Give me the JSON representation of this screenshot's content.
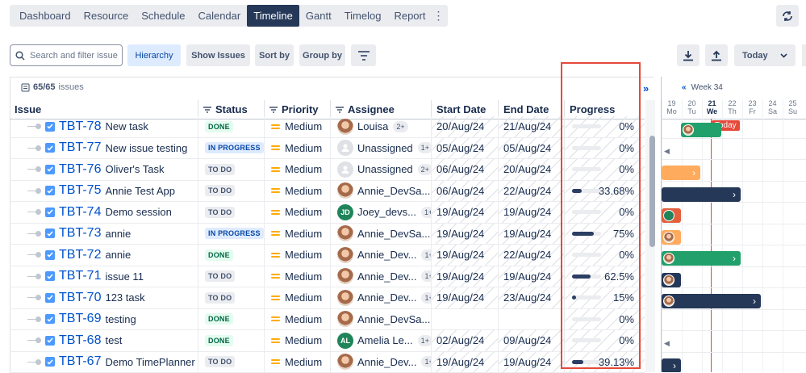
{
  "nav": {
    "tabs": [
      "Dashboard",
      "Resource",
      "Schedule",
      "Calendar",
      "Timeline",
      "Gantt",
      "Timelog",
      "Report"
    ],
    "active_tab": "Timeline",
    "more_icon": "more-vertical-icon",
    "refresh_icon": "refresh-icon"
  },
  "toolbar": {
    "search_placeholder": "Search and filter issue",
    "hierarchy": "Hierarchy",
    "show_issues": "Show Issues",
    "sort_by": "Sort by",
    "group_by": "Group by",
    "filter_icon": "filter-lines-icon",
    "download_icon": "download-icon",
    "upload_icon": "upload-icon",
    "range": "Today"
  },
  "summary": {
    "count": "65/65",
    "label": "issues"
  },
  "columns": {
    "issue": "Issue",
    "status": "Status",
    "priority": "Priority",
    "assignee": "Assignee",
    "start": "Start Date",
    "end": "End Date",
    "progress": "Progress"
  },
  "rows": [
    {
      "key": "TBT-78",
      "title": "New task",
      "status": "DONE",
      "priority": "Medium",
      "assignee": "Louisa",
      "badge": "2+",
      "avatar": "photo",
      "start": "20/Aug/24",
      "end": "21/Aug/24",
      "progress": "0%",
      "fill": 0
    },
    {
      "key": "TBT-77",
      "title": "New issue testing",
      "status": "IN PROGRESS",
      "priority": "Medium",
      "assignee": "Unassigned",
      "badge": "1+",
      "avatar": "unassigned",
      "start": "05/Aug/24",
      "end": "05/Aug/24",
      "progress": "0%",
      "fill": 0
    },
    {
      "key": "TBT-76",
      "title": "Oliver's Task",
      "status": "TO DO",
      "priority": "Medium",
      "assignee": "Unassigned",
      "badge": "2+",
      "avatar": "unassigned",
      "start": "06/Aug/24",
      "end": "20/Aug/24",
      "progress": "0%",
      "fill": 0
    },
    {
      "key": "TBT-75",
      "title": "Annie Test App",
      "status": "TO DO",
      "priority": "Medium",
      "assignee": "Annie_DevSa...",
      "badge": "",
      "avatar": "photo",
      "start": "06/Aug/24",
      "end": "22/Aug/24",
      "progress": "33.68%",
      "fill": 0.3368
    },
    {
      "key": "TBT-74",
      "title": "Demo session",
      "status": "TO DO",
      "priority": "Medium",
      "assignee": "Joey_devs...",
      "badge": "1+",
      "avatar": "JD",
      "start": "19/Aug/24",
      "end": "19/Aug/24",
      "progress": "0%",
      "fill": 0
    },
    {
      "key": "TBT-73",
      "title": "annie",
      "status": "IN PROGRESS",
      "priority": "Medium",
      "assignee": "Annie_DevSa...",
      "badge": "",
      "avatar": "photo",
      "start": "19/Aug/24",
      "end": "19/Aug/24",
      "progress": "75%",
      "fill": 0.75
    },
    {
      "key": "TBT-72",
      "title": "annie",
      "status": "DONE",
      "priority": "Medium",
      "assignee": "Annie_Dev...",
      "badge": "1+",
      "avatar": "photo",
      "start": "19/Aug/24",
      "end": "22/Aug/24",
      "progress": "0%",
      "fill": 0
    },
    {
      "key": "TBT-71",
      "title": "issue 11",
      "status": "TO DO",
      "priority": "Medium",
      "assignee": "Annie_Dev...",
      "badge": "1+",
      "avatar": "photo",
      "start": "19/Aug/24",
      "end": "19/Aug/24",
      "progress": "62.5%",
      "fill": 0.625
    },
    {
      "key": "TBT-70",
      "title": "123 task",
      "status": "TO DO",
      "priority": "Medium",
      "assignee": "Annie_Dev...",
      "badge": "1+",
      "avatar": "photo",
      "start": "19/Aug/24",
      "end": "23/Aug/24",
      "progress": "15%",
      "fill": 0.15
    },
    {
      "key": "TBT-69",
      "title": "testing",
      "status": "DONE",
      "priority": "Medium",
      "assignee": "Annie_DevSa...",
      "badge": "",
      "avatar": "photo",
      "start": "",
      "end": "",
      "progress": "0%",
      "fill": 0
    },
    {
      "key": "TBT-68",
      "title": "test",
      "status": "DONE",
      "priority": "Medium",
      "assignee": "Amelia Le...",
      "badge": "1+",
      "avatar": "AL",
      "start": "02/Aug/24",
      "end": "09/Aug/24",
      "progress": "0%",
      "fill": 0
    },
    {
      "key": "TBT-67",
      "title": "Demo TimePlanner",
      "status": "TO DO",
      "priority": "Medium",
      "assignee": "Annie_Dev...",
      "badge": "1+",
      "avatar": "photo",
      "start": "19/Aug/24",
      "end": "19/Aug/24",
      "progress": "39.13%",
      "fill": 0.3913
    }
  ],
  "timeline": {
    "week": "Week 34",
    "today_label": "Today",
    "days": [
      {
        "num": "19",
        "dow": "Mo"
      },
      {
        "num": "20",
        "dow": "Tu"
      },
      {
        "num": "21",
        "dow": "We",
        "today": true
      },
      {
        "num": "22",
        "dow": "Th"
      },
      {
        "num": "23",
        "dow": "Fr"
      },
      {
        "num": "24",
        "dow": "Sa"
      },
      {
        "num": "25",
        "dow": "Su"
      }
    ],
    "colors": {
      "done": "#22a06b",
      "todo": "#253858",
      "orange": "#ffab5e",
      "today": "#e5493a"
    }
  }
}
